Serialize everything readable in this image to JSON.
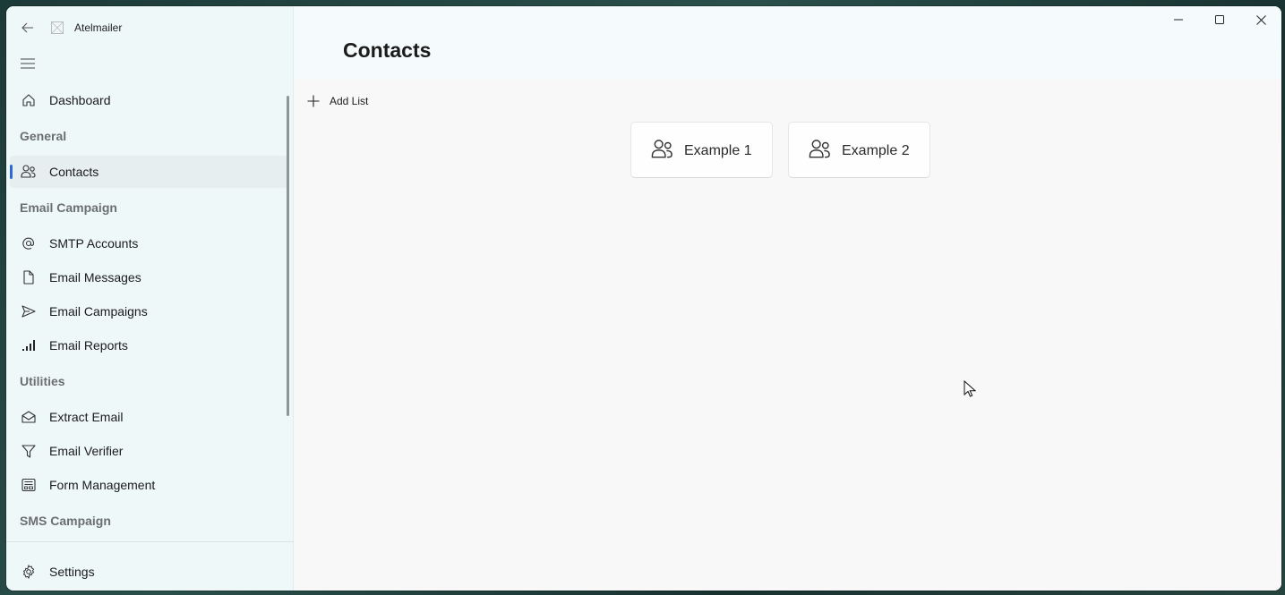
{
  "app": {
    "title": "Atelmailer"
  },
  "window_controls": {
    "minimize": "minimize",
    "maximize": "maximize",
    "close": "close"
  },
  "sidebar": {
    "items": [
      {
        "type": "item",
        "label": "Dashboard",
        "icon": "home-icon"
      },
      {
        "type": "section",
        "label": "General"
      },
      {
        "type": "item",
        "label": "Contacts",
        "icon": "people-icon",
        "active": true
      },
      {
        "type": "section",
        "label": "Email Campaign"
      },
      {
        "type": "item",
        "label": "SMTP Accounts",
        "icon": "at-sign-icon"
      },
      {
        "type": "item",
        "label": "Email Messages",
        "icon": "document-icon"
      },
      {
        "type": "item",
        "label": "Email Campaigns",
        "icon": "send-icon"
      },
      {
        "type": "item",
        "label": "Email Reports",
        "icon": "signal-bars-icon"
      },
      {
        "type": "section",
        "label": "Utilities"
      },
      {
        "type": "item",
        "label": "Extract Email",
        "icon": "open-envelope-icon"
      },
      {
        "type": "item",
        "label": "Email Verifier",
        "icon": "filter-icon"
      },
      {
        "type": "item",
        "label": "Form Management",
        "icon": "form-icon"
      },
      {
        "type": "section",
        "label": "SMS Campaign"
      }
    ],
    "footer": {
      "settings_label": "Settings"
    }
  },
  "main": {
    "page_title": "Contacts",
    "add_list_label": "Add List",
    "lists": [
      {
        "label": "Example 1"
      },
      {
        "label": "Example 2"
      }
    ]
  },
  "colors": {
    "accent": "#2b6cd4",
    "sidebar_bg": "#eef8f9",
    "content_bg": "#f8f8f8"
  }
}
